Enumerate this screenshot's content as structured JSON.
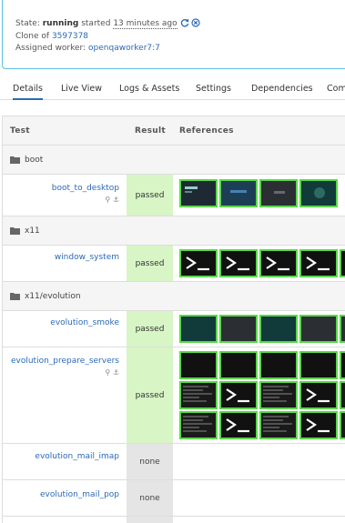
{
  "info": {
    "state_label": "State:",
    "state_value": "running",
    "started_label": "started",
    "started_time": "13 minutes ago",
    "clone_label": "Clone of",
    "clone_id": "3597378",
    "worker_label": "Assigned worker:",
    "worker_name": "openqaworker7:7"
  },
  "tabs": [
    {
      "label": "Details",
      "active": true
    },
    {
      "label": "Live View"
    },
    {
      "label": "Logs & Assets"
    },
    {
      "label": "Settings"
    },
    {
      "label": "Dependencies"
    },
    {
      "label": "Com"
    }
  ],
  "table": {
    "headers": {
      "test": "Test",
      "result": "Result",
      "references": "References"
    },
    "groups": [
      {
        "label": "boot"
      },
      {
        "label": "x11"
      },
      {
        "label": "x11/evolution"
      }
    ],
    "rows": [
      {
        "name": "boot_to_desktop",
        "result": "passed"
      },
      {
        "name": "window_system",
        "result": "passed"
      },
      {
        "name": "evolution_smoke",
        "result": "passed"
      },
      {
        "name": "evolution_prepare_servers",
        "result": "passed"
      },
      {
        "name": "evolution_mail_imap",
        "result": "none"
      },
      {
        "name": "evolution_mail_pop",
        "result": "none"
      }
    ]
  },
  "colors": {
    "link": "#2a6ab8",
    "panel_border": "#5bc0de",
    "passed_bg": "#d8f5c6",
    "none_bg": "#e5e5e5",
    "thumb_border": "#59d84a"
  },
  "icons": [
    "restart-icon",
    "cancel-icon",
    "folder-icon",
    "pin-icon",
    "anchor-icon",
    "terminal-icon"
  ]
}
